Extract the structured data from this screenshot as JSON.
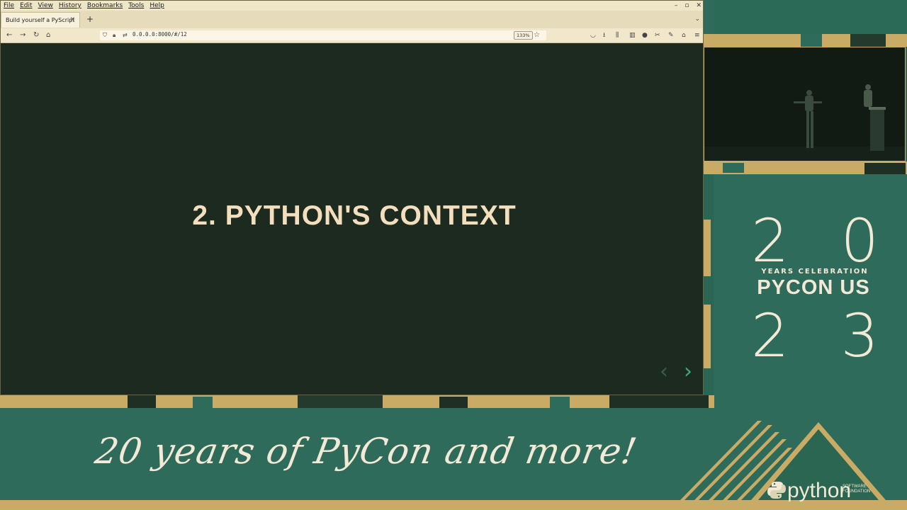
{
  "browser": {
    "menu": [
      "File",
      "Edit",
      "View",
      "History",
      "Bookmarks",
      "Tools",
      "Help"
    ],
    "window_controls": [
      "–",
      "▫",
      "✕"
    ],
    "tab": {
      "title": "Build yourself a PyScript",
      "close": "✕"
    },
    "new_tab": "+",
    "tab_list": "⌄",
    "url": "0.0.0.0:8000/#/12",
    "zoom": "133%"
  },
  "slide": {
    "title": "2. PYTHON'S CONTEXT",
    "prev": "‹",
    "next": "›"
  },
  "branding": {
    "year_top": [
      "2",
      "0"
    ],
    "years_celebration": "YEARS CELEBRATION",
    "pycon_us": "PYCON US",
    "year_bottom": [
      "2",
      "3"
    ],
    "tagline": "20 years of PyCon and more!",
    "psf_name": "python",
    "psf_sub": "SOFTWARE FOUNDATION"
  },
  "colors": {
    "slide_bg": "#1c2a1f",
    "slide_title": "#f3dfbd",
    "brand_green": "#2e6b5a",
    "brand_gold": "#c9ab66",
    "next_arrow": "#3fa88c"
  }
}
